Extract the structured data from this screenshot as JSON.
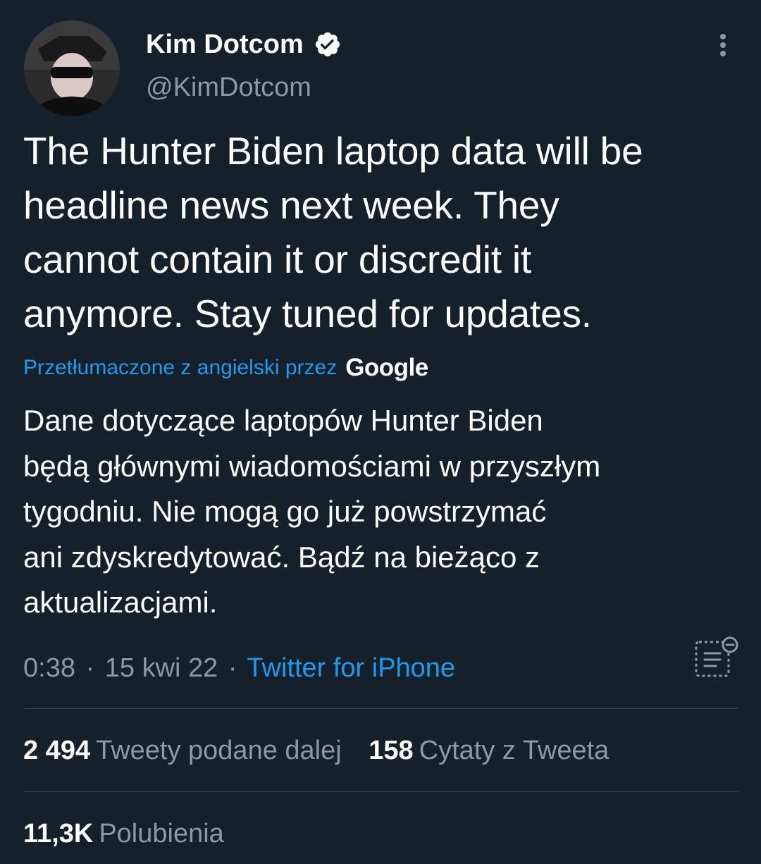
{
  "tweet": {
    "author": {
      "name": "Kim Dotcom",
      "handle": "@KimDotcom",
      "verified": true
    },
    "text": "The Hunter Biden laptop data will be\nheadline news next week. They\ncannot contain it or discredit it\nanymore. Stay tuned for updates.",
    "translation": {
      "label": "Przetłumaczone z angielski przez",
      "provider": "Google",
      "text": "Dane dotyczące laptopów Hunter Biden\nbędą głównymi wiadomościami w przyszłym\ntygodniu. Nie mogą go już powstrzymać\nani zdyskredytować. Bądź na bieżąco z\naktualizacjami."
    },
    "time": "0:38",
    "date": "15 kwi 22",
    "source": "Twitter for iPhone",
    "separator": "·"
  },
  "stats": {
    "retweets": {
      "count": "2 494",
      "label": "Tweety podane dalej"
    },
    "quotes": {
      "count": "158",
      "label": "Cytaty z Tweeta"
    },
    "likes": {
      "count": "11,3K",
      "label": "Polubienia"
    }
  },
  "icons": {
    "more": "more-vertical-icon",
    "verified": "verified-badge-icon",
    "analytics": "analytics-icon"
  },
  "colors": {
    "background": "#15202b",
    "text": "#ffffff",
    "secondary": "#8b98a5",
    "accent": "#1d9bf0",
    "divider": "#38444d"
  }
}
